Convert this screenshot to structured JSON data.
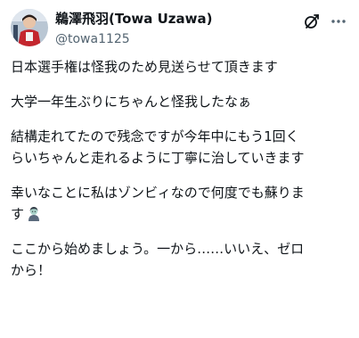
{
  "author": {
    "display_name": "鵜澤飛羽(Towa Uzawa)",
    "handle": "@towa1125"
  },
  "icons": {
    "avatar": "avatar-photo",
    "grok": "grok-slash-icon",
    "more": "more-dots-icon",
    "emoji": "zombie-emoji"
  },
  "tweet": {
    "p1": "日本選手権は怪我のため見送らせて頂きます",
    "p2": "大学一年生ぶりにちゃんと怪我したなぁ",
    "p3_line1": "結構走れてたので残念ですが今年中にもう1回く",
    "p3_line2": "らいちゃんと走れるように丁寧に治していきます",
    "p4_line1": "幸いなことに私はゾンビィなので何度でも蘇りま",
    "p4_line2": "す",
    "p5_line1": "ここから始めましょう。一から……いいえ、ゼロ",
    "p5_line2": "から！"
  }
}
